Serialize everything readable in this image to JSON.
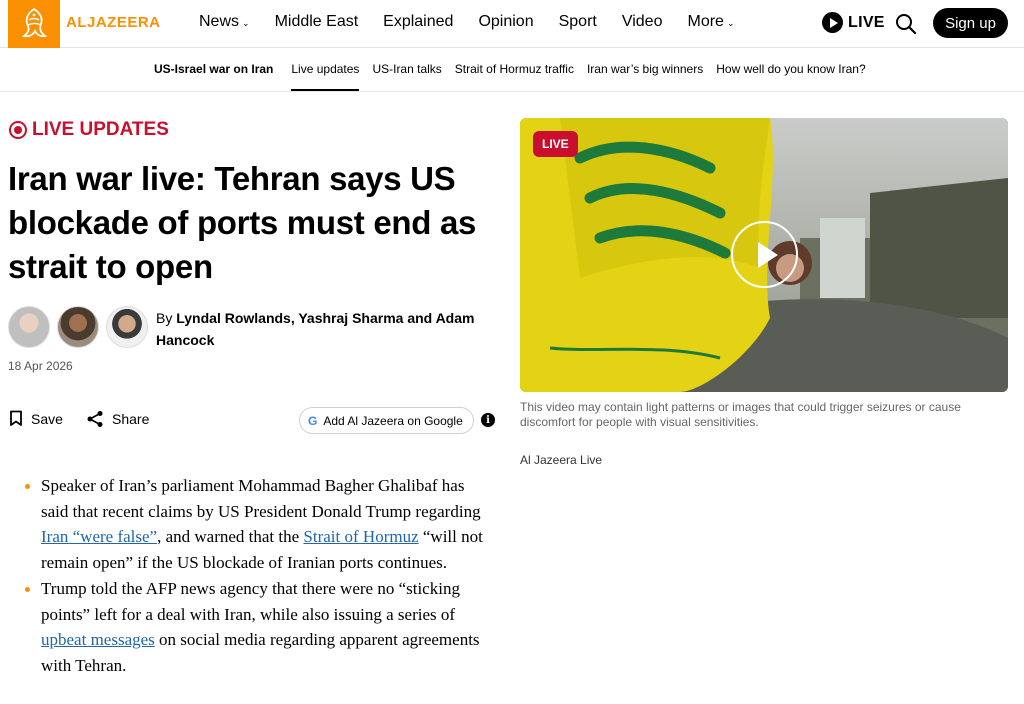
{
  "header": {
    "logo_text": "ALJAZEERA",
    "brand_color": "#fa9000",
    "nav": [
      {
        "label": "News",
        "dropdown": true
      },
      {
        "label": "Middle East",
        "dropdown": false
      },
      {
        "label": "Explained",
        "dropdown": false
      },
      {
        "label": "Opinion",
        "dropdown": false
      },
      {
        "label": "Sport",
        "dropdown": false
      },
      {
        "label": "Video",
        "dropdown": false
      },
      {
        "label": "More",
        "dropdown": true
      }
    ],
    "live_label": "LIVE",
    "signup_label": "Sign up"
  },
  "subnav": {
    "items": [
      {
        "label": "US-Israel war on Iran",
        "bold": true,
        "active": false
      },
      {
        "label": "Live updates",
        "bold": false,
        "active": true
      },
      {
        "label": "US-Iran talks",
        "bold": false,
        "active": false
      },
      {
        "label": "Strait of Hormuz traffic",
        "bold": false,
        "active": false
      },
      {
        "label": "Iran war’s big winners",
        "bold": false,
        "active": false
      },
      {
        "label": "How well do you know Iran?",
        "bold": false,
        "active": false
      }
    ]
  },
  "article": {
    "live_label": "LIVE UPDATES",
    "live_color": "#c8102e",
    "headline": "Iran war live: Tehran says US blockade of ports must end as strait to open",
    "byline_prefix": "By ",
    "byline_names": "Lyndal Rowlands, Yashraj Sharma and Adam Hancock",
    "date": "18 Apr 2026",
    "save_label": "Save",
    "share_label": "Share",
    "google_label": "Add Al Jazeera on Google",
    "bullets": [
      {
        "parts": [
          {
            "text": "Speaker of Iran’s parliament Mohammad Bagher Ghalibaf has said that recent claims by US President Donald Trump regarding ",
            "link": false
          },
          {
            "text": "Iran “were false”",
            "link": true
          },
          {
            "text": ", and warned that the ",
            "link": false
          },
          {
            "text": "Strait of Hormuz",
            "link": true
          },
          {
            "text": " “will not remain open” if the US blockade of Iranian ports continues.",
            "link": false
          }
        ]
      },
      {
        "parts": [
          {
            "text": "Trump told the AFP news agency that there were no “sticking points” left for a deal with Iran, while also issuing a series of ",
            "link": false
          },
          {
            "text": "upbeat messages",
            "link": true
          },
          {
            "text": " on social media regarding apparent agreements with Tehran.",
            "link": false
          }
        ]
      }
    ]
  },
  "video": {
    "badge": "LIVE",
    "disclaimer": "This video may contain light patterns or images that could trigger seizures or cause discomfort for people with visual sensitivities.",
    "source": "Al Jazeera Live"
  }
}
